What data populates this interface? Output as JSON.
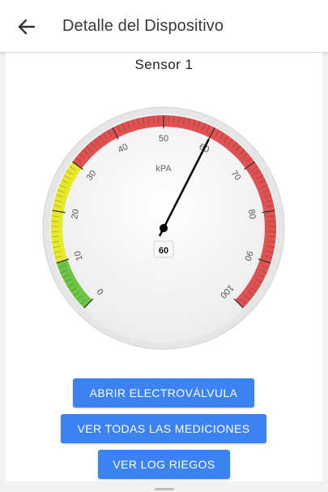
{
  "header": {
    "title": "Detalle del Dispositivo",
    "back_icon": "arrow-left-icon"
  },
  "sensor": {
    "name": "Sensor 1"
  },
  "gauge": {
    "unit": "kPA",
    "value": 60,
    "value_label": "60",
    "min": 0,
    "max": 100,
    "major_ticks": [
      "0",
      "10",
      "20",
      "30",
      "40",
      "50",
      "60",
      "70",
      "80",
      "90",
      "100"
    ],
    "bands": [
      {
        "from": 0,
        "to": 10,
        "color": "#6cc644"
      },
      {
        "from": 10,
        "to": 30,
        "color": "#e8e82a"
      },
      {
        "from": 30,
        "to": 100,
        "color": "#e05252"
      }
    ]
  },
  "actions": {
    "open_valve": "ABRIR ELECTROVÁLVULA",
    "view_measurements": "VER TODAS LAS MEDICIONES",
    "view_irrigation_log": "VER LOG RIEGOS"
  },
  "colors": {
    "primary": "#3d82f3",
    "needle": "#000000"
  }
}
